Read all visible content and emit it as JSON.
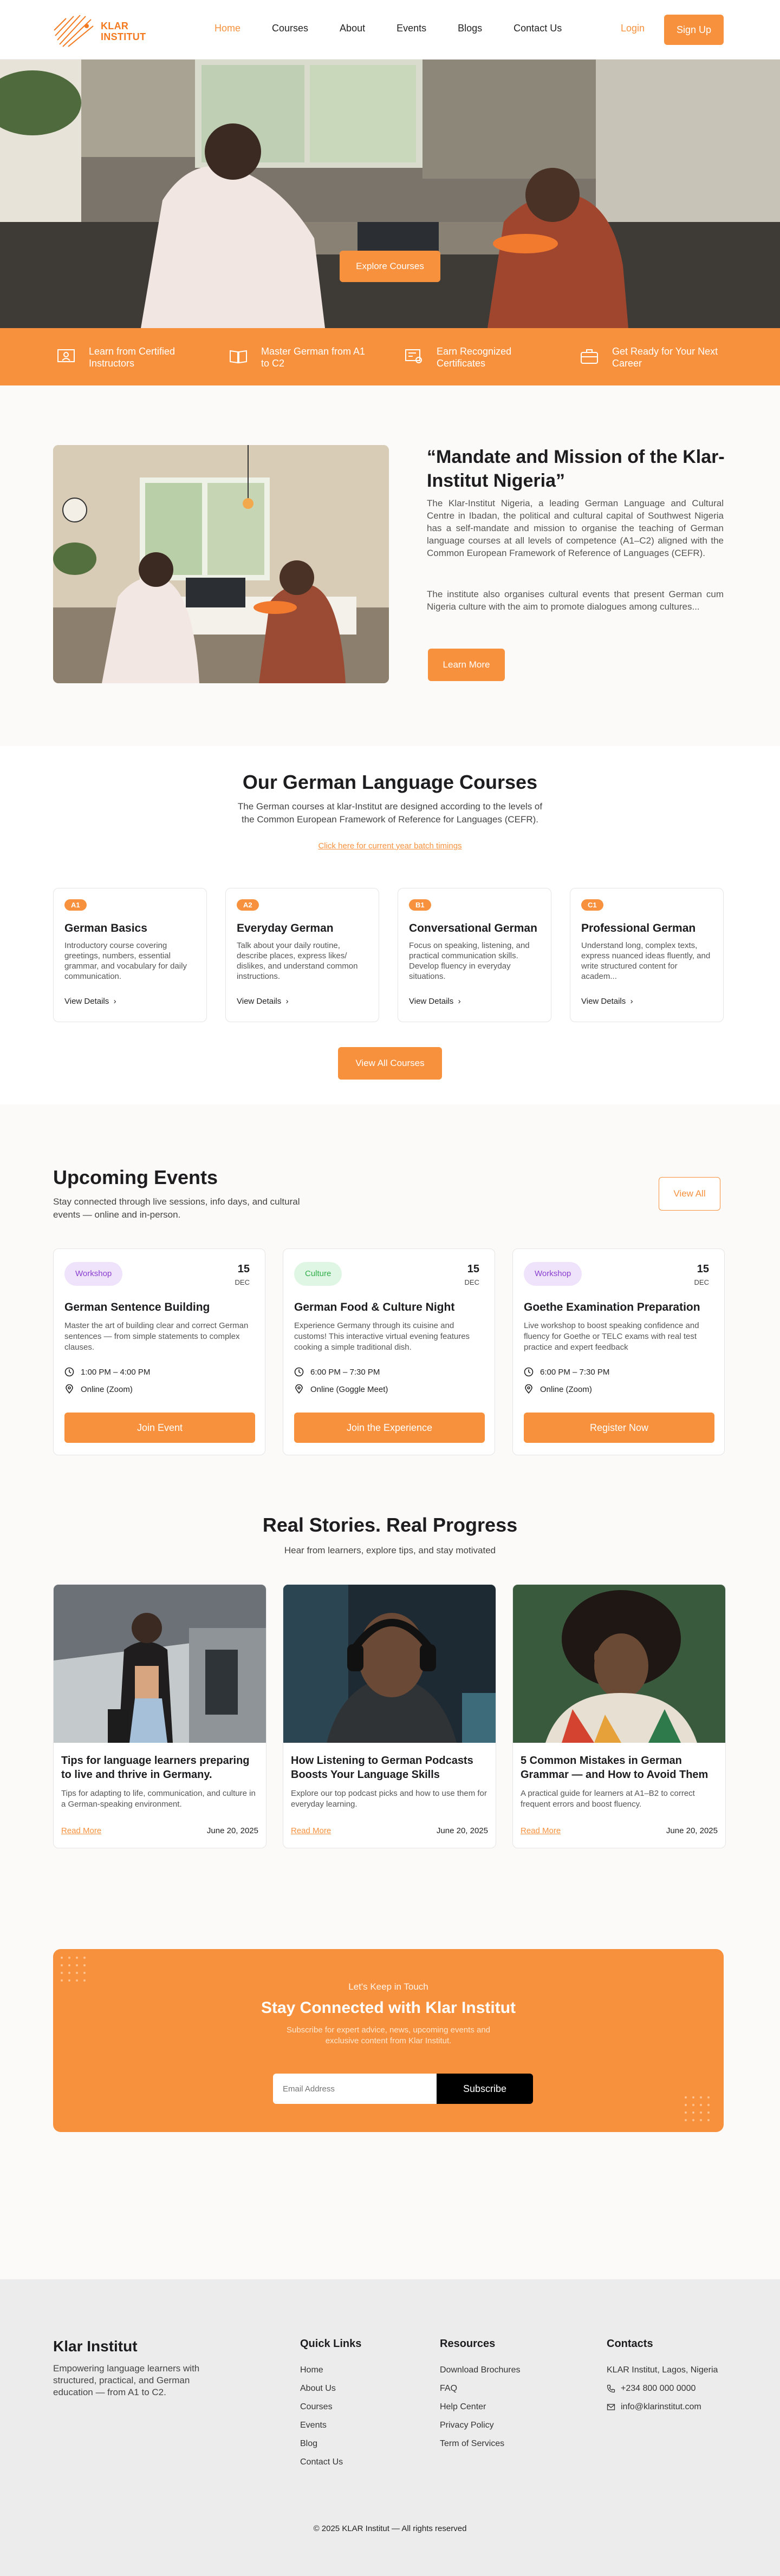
{
  "brand": {
    "logo_line1": "KLAR",
    "logo_line2": "INSTITUT"
  },
  "nav": {
    "links": [
      "Home",
      "Courses",
      "About",
      "Events",
      "Blogs",
      "Contact Us"
    ],
    "active": "Home",
    "login_label": "Login",
    "signup_label": "Sign Up"
  },
  "hero": {
    "cta_label": "Explore Courses"
  },
  "features": [
    {
      "icon": "certificate-instructor-icon",
      "text": "Learn from Certified Instructors"
    },
    {
      "icon": "open-book-icon",
      "text": "Master German from A1 to C2"
    },
    {
      "icon": "certificate-badge-icon",
      "text": "Earn Recognized Certificates"
    },
    {
      "icon": "briefcase-icon",
      "text": "Get Ready for Your Next Career"
    }
  ],
  "mission": {
    "title": "“Mandate and Mission of the Klar-Institut Nigeria”",
    "paragraph1": "The Klar-Institut Nigeria, a leading German Language and Cultural Centre in Ibadan, the political and cultural capital of Southwest Nigeria has a self-mandate and mission to organise the teaching of German language courses at all levels of competence (A1–C2) aligned with the Common European Framework of Reference of Languages (CEFR).",
    "paragraph2": "The institute also organises cultural events that present German cum Nigeria culture with the aim to promote dialogues among cultures...",
    "cta_label": "Learn More"
  },
  "courses": {
    "title": "Our German Language Courses",
    "subtitle": "The German courses at klar-Institut are designed according to the levels of the Common European Framework of Reference for Languages (CEFR).",
    "batch_link": "Click here for current year batch timings",
    "items": [
      {
        "level": "A1",
        "name": "German Basics",
        "desc": "Introductory course covering greetings, numbers, essential grammar, and vocabulary for daily communication.",
        "link": "View Details"
      },
      {
        "level": "A2",
        "name": "Everyday German",
        "desc": "Talk about your daily routine, describe places, express likes/ dislikes, and understand common instructions.",
        "link": "View Details"
      },
      {
        "level": "B1",
        "name": "Conversational German",
        "desc": "Focus on speaking, listening, and practical communication skills. Develop fluency in everyday situations.",
        "link": "View Details"
      },
      {
        "level": "C1",
        "name": "Professional German",
        "desc": "Understand long, complex texts, express nuanced ideas fluently, and write structured content for academ...",
        "link": "View Details"
      }
    ],
    "view_all_label": "View All Courses"
  },
  "events": {
    "title": "Upcoming Events",
    "subtitle": "Stay connected through live sessions, info days, and cultural events — online and in-person.",
    "view_all_label": "View All",
    "items": [
      {
        "tag": "Workshop",
        "tag_color": "#8a3fd0",
        "day": "15",
        "month": "DEC",
        "title": "German Sentence Building",
        "desc": "Master the art of building clear and correct German sentences — from simple statements to complex clauses.",
        "time": "1:00 PM – 4:00 PM",
        "location": "Online (Zoom)",
        "cta": "Join Event"
      },
      {
        "tag": "Culture",
        "tag_color": "#2fae4a",
        "day": "15",
        "month": "DEC",
        "title": "German Food & Culture Night",
        "desc": "Experience Germany through its cuisine and customs! This interactive virtual evening features cooking a simple traditional dish.",
        "time": "6:00 PM – 7:30 PM",
        "location": "Online (Goggle Meet)",
        "cta": "Join the Experience"
      },
      {
        "tag": "Workshop",
        "tag_color": "#8a3fd0",
        "day": "15",
        "month": "DEC",
        "title": "Goethe Examination Preparation",
        "desc": "Live workshop to boost speaking confidence and fluency for Goethe or TELC exams with real test practice and expert feedback",
        "time": "6:00 PM – 7:30 PM",
        "location": "Online (Zoom)",
        "cta": "Register Now"
      }
    ]
  },
  "stories": {
    "title": "Real Stories. Real Progress",
    "subtitle": "Hear from learners, explore tips, and stay motivated",
    "items": [
      {
        "title": "Tips for language learners preparing to live and thrive in Germany.",
        "desc": "Tips for adapting to life, communication, and culture in a German-speaking environment.",
        "read_more": "Read More",
        "date": "June 20, 2025"
      },
      {
        "title": "How Listening to German Podcasts Boosts Your Language Skills",
        "desc": "Explore our top podcast picks and how to use them for everyday learning.",
        "read_more": "Read More",
        "date": "June 20, 2025"
      },
      {
        "title": "5 Common Mistakes in German Grammar — and How to Avoid Them",
        "desc": "A practical guide for learners at A1–B2 to correct frequent errors and boost fluency.",
        "read_more": "Read More",
        "date": "June 20, 2025"
      }
    ]
  },
  "newsletter": {
    "kicker": "Let's Keep in Touch",
    "title": "Stay Connected with Klar Institut",
    "subtitle": "Subscribe for expert advice, news, upcoming events and exclusive content from Klar Institut.",
    "placeholder": "Email Address",
    "button": "Subscribe"
  },
  "footer": {
    "brand": "Klar Institut",
    "tagline": "Empowering language learners with structured, practical, and German education — from A1 to C2.",
    "quick_links": {
      "title": "Quick Links",
      "items": [
        "Home",
        "About Us",
        "Courses",
        "Events",
        "Blog",
        "Contact Us"
      ]
    },
    "resources": {
      "title": "Resources",
      "items": [
        "Download Brochures",
        "FAQ",
        "Help Center",
        "Privacy Policy",
        "Term of Services"
      ]
    },
    "contacts": {
      "title": "Contacts",
      "address": "KLAR Institut, Lagos, Nigeria",
      "phone": "+234 800 000 0000",
      "email": "info@klarinstitut.com"
    },
    "copyright": "© 2025 KLAR Institut — All rights reserved"
  },
  "colors": {
    "accent": "#f7913d",
    "dark": "#1d1d1f"
  }
}
